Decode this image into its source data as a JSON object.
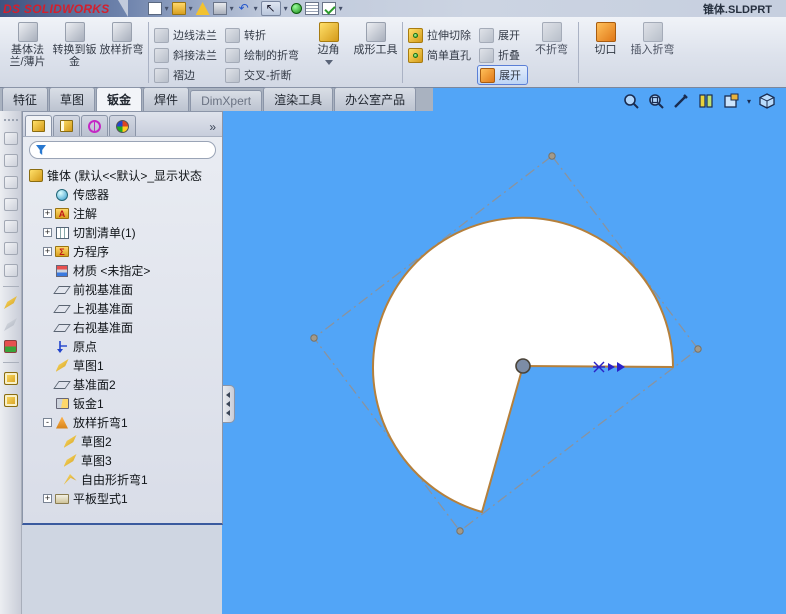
{
  "window": {
    "brand": "DS SOLIDWORKS",
    "doc_title": "锥体.SLDPRT"
  },
  "icons": {
    "undo": "↶",
    "select": "↖",
    "dropdown": "▾",
    "overflow": "»",
    "annotation_letter": "A",
    "equation_letter": "Σ",
    "plus": "+",
    "minus": "-"
  },
  "menubar": {
    "buttons": [
      "new",
      "open",
      "save",
      "print",
      "undo",
      "select",
      "rebuild",
      "options",
      "task-pane"
    ]
  },
  "ribbon": {
    "buttons": [
      {
        "label": "基体法兰/薄片",
        "enabled": true
      },
      {
        "label": "转换到钣金",
        "enabled": true
      },
      {
        "label": "放样折弯",
        "enabled": true
      },
      {
        "label": "边线法兰",
        "enabled": false
      },
      {
        "label": "斜接法兰",
        "enabled": false
      },
      {
        "label": "褶边",
        "enabled": false
      },
      {
        "label": "转折",
        "enabled": false
      },
      {
        "label": "绘制的折弯",
        "enabled": false
      },
      {
        "label": "交叉-折断",
        "enabled": false
      },
      {
        "label": "边角",
        "enabled": true
      },
      {
        "label": "成形工具",
        "enabled": true
      },
      {
        "label": "拉伸切除",
        "enabled": true
      },
      {
        "label": "简单直孔",
        "enabled": true
      },
      {
        "label": "展开",
        "enabled": false
      },
      {
        "label": "折叠",
        "enabled": false
      },
      {
        "label": "展开",
        "enabled": true,
        "active": true
      },
      {
        "label": "不折弯",
        "enabled": false
      },
      {
        "label": "切口",
        "enabled": true
      },
      {
        "label": "插入折弯",
        "enabled": false
      }
    ]
  },
  "tabs": [
    {
      "label": "特征"
    },
    {
      "label": "草图"
    },
    {
      "label": "钣金",
      "active": true
    },
    {
      "label": "焊件"
    },
    {
      "label": "DimXpert"
    },
    {
      "label": "渲染工具"
    },
    {
      "label": "办公室产品"
    }
  ],
  "headsup": {
    "buttons": [
      "zoom-fit",
      "zoom-area",
      "previous-view",
      "section-view",
      "view-orientation",
      "display-style"
    ]
  },
  "left_toolbar": {
    "buttons": [
      "view-front",
      "view-back",
      "view-left",
      "view-right",
      "view-top",
      "view-bottom",
      "view-isometric",
      "sketch",
      "3d-sketch",
      "reference-geometry",
      "feature-a",
      "feature-b"
    ]
  },
  "tree": {
    "manager_tabs": [
      "featuremanager",
      "propertymanager",
      "configurationmanager",
      "displaymanager"
    ],
    "filter_value": "",
    "root_label": "锥体 (默认<<默认>_显示状态",
    "items": [
      {
        "label": "传感器",
        "level": 1,
        "expander": ""
      },
      {
        "label": "注解",
        "level": 1,
        "expander": "+"
      },
      {
        "label": "切割清单(1)",
        "level": 1,
        "expander": "+"
      },
      {
        "label": "方程序",
        "level": 1,
        "expander": "+"
      },
      {
        "label": "材质 <未指定>",
        "level": 1,
        "expander": ""
      },
      {
        "label": "前视基准面",
        "level": 1,
        "expander": ""
      },
      {
        "label": "上视基准面",
        "level": 1,
        "expander": ""
      },
      {
        "label": "右视基准面",
        "level": 1,
        "expander": ""
      },
      {
        "label": "原点",
        "level": 1,
        "expander": ""
      },
      {
        "label": "草图1",
        "level": 1,
        "expander": ""
      },
      {
        "label": "基准面2",
        "level": 1,
        "expander": ""
      },
      {
        "label": "钣金1",
        "level": 1,
        "expander": ""
      },
      {
        "label": "放样折弯1",
        "level": 1,
        "expander": "-"
      },
      {
        "label": "草图2",
        "level": 2,
        "expander": ""
      },
      {
        "label": "草图3",
        "level": 2,
        "expander": ""
      },
      {
        "label": "自由形折弯1",
        "level": 2,
        "expander": ""
      },
      {
        "label": "平板型式1",
        "level": 1,
        "expander": "+"
      }
    ]
  },
  "viewport": {
    "background": "#52a5f7",
    "shape": "flat-pattern-of-cone",
    "outline_color": "#b5803c",
    "bbox_color": "#8a939e",
    "marker_color": "#2a23c8"
  }
}
